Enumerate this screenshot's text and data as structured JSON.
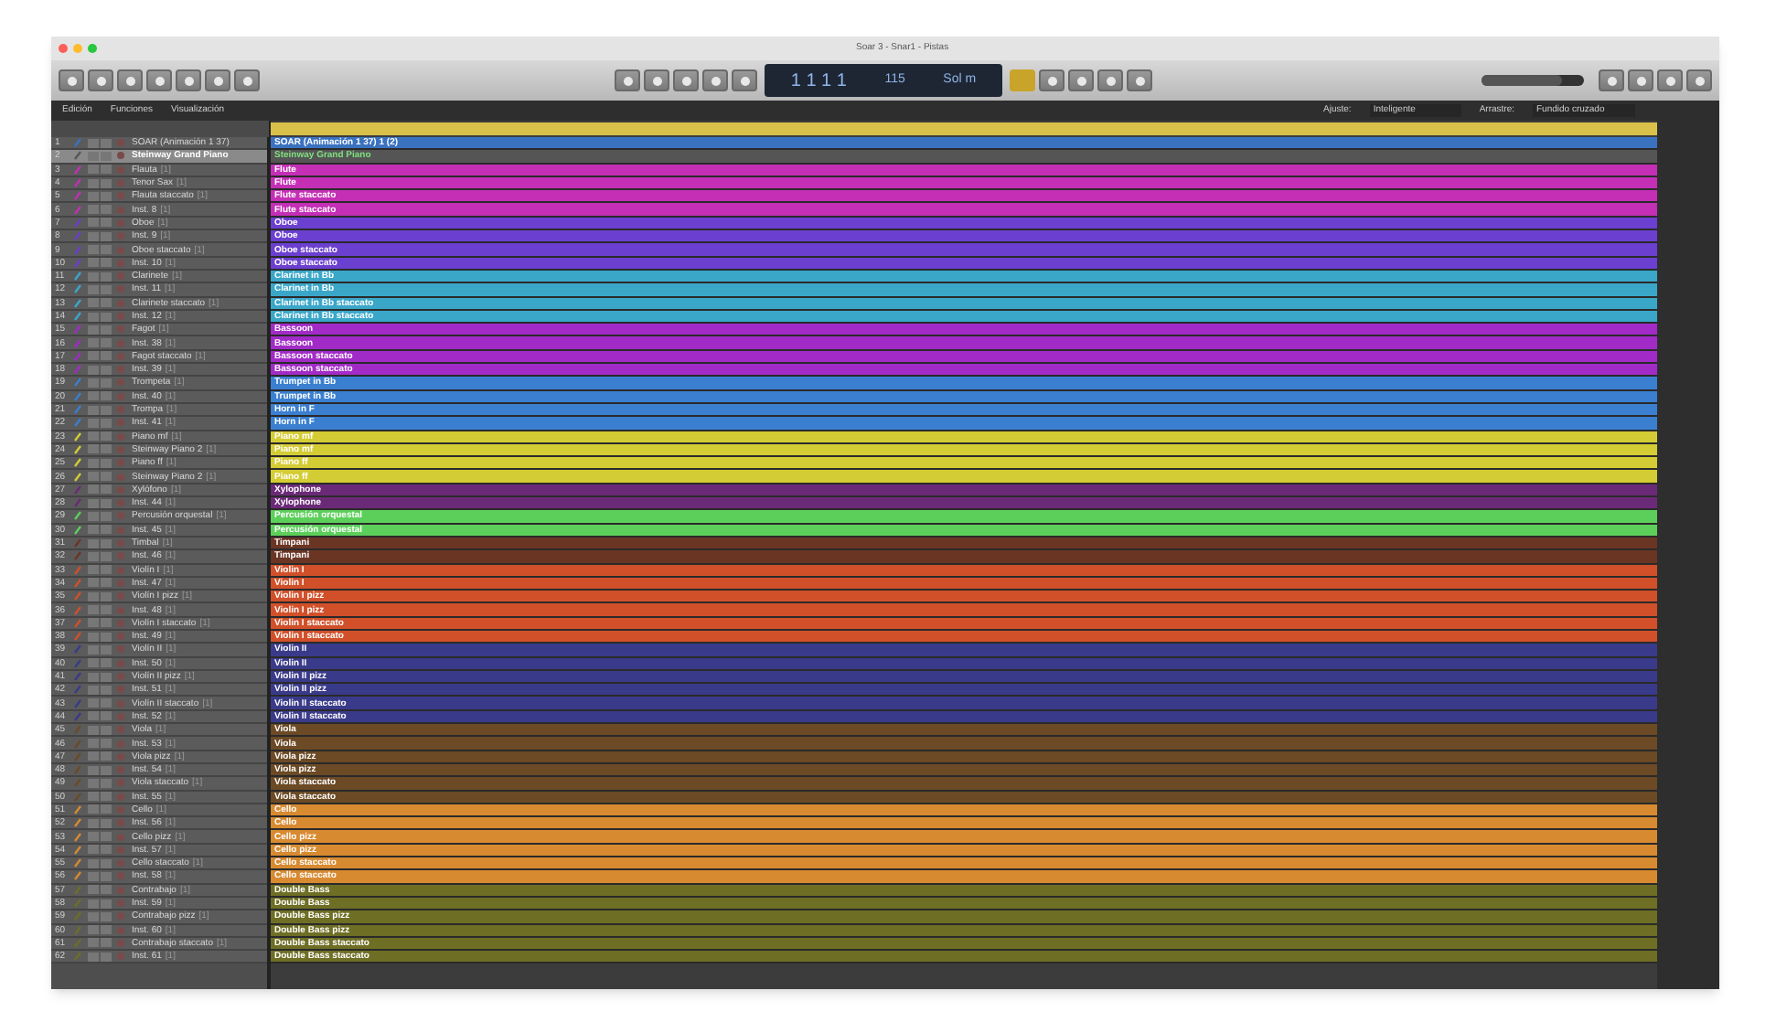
{
  "window": {
    "title": "Soar 3 - Snar1 - Pistas"
  },
  "lcd": {
    "position": "1 1 1 1",
    "tempo": "115",
    "key": "Sol m"
  },
  "master_volume": {
    "level": 0.78
  },
  "menu": [
    "Edición",
    "Funciones",
    "Visualización"
  ],
  "snap": {
    "label": "Ajuste:",
    "value": "Inteligente"
  },
  "drag": {
    "label": "Arrastre:",
    "value": "Fundido cruzado"
  },
  "tracks": [
    {
      "number": "1",
      "name": "SOAR (Animación 1 37)",
      "region": "SOAR (Animación 1 37) 1 (2)",
      "color": "#3a72c0",
      "selected": false
    },
    {
      "number": "2",
      "name": "Steinway Grand Piano",
      "region": "Steinway Grand Piano",
      "color": "#555555",
      "selected": true
    },
    {
      "number": "3",
      "name": "Flauta",
      "tag": "[1]",
      "region": "Flute",
      "color": "#c42fb5",
      "selected": false
    },
    {
      "number": "4",
      "name": "Tenor Sax",
      "tag": "[1]",
      "region": "Flute",
      "color": "#c42fb5",
      "selected": false
    },
    {
      "number": "5",
      "name": "Flauta staccato",
      "tag": "[1]",
      "region": "Flute staccato",
      "color": "#c42fb5",
      "selected": false
    },
    {
      "number": "6",
      "name": "Inst. 8",
      "tag": "[1]",
      "region": "Flute staccato",
      "color": "#c42fb5",
      "selected": false
    },
    {
      "number": "7",
      "name": "Oboe",
      "tag": "[1]",
      "region": "Oboe",
      "color": "#6b3fd0",
      "selected": false
    },
    {
      "number": "8",
      "name": "Inst. 9",
      "tag": "[1]",
      "region": "Oboe",
      "color": "#6b3fd0",
      "selected": false
    },
    {
      "number": "9",
      "name": "Oboe staccato",
      "tag": "[1]",
      "region": "Oboe staccato",
      "color": "#6b3fd0",
      "selected": false
    },
    {
      "number": "10",
      "name": "Inst. 10",
      "tag": "[1]",
      "region": "Oboe staccato",
      "color": "#6b3fd0",
      "selected": false
    },
    {
      "number": "11",
      "name": "Clarinete",
      "tag": "[1]",
      "region": "Clarinet in Bb",
      "color": "#3aa7c9",
      "selected": false
    },
    {
      "number": "12",
      "name": "Inst. 11",
      "tag": "[1]",
      "region": "Clarinet in Bb",
      "color": "#3aa7c9",
      "selected": false
    },
    {
      "number": "13",
      "name": "Clarinete staccato",
      "tag": "[1]",
      "region": "Clarinet in Bb staccato",
      "color": "#3aa7c9",
      "selected": false
    },
    {
      "number": "14",
      "name": "Inst. 12",
      "tag": "[1]",
      "region": "Clarinet in Bb staccato",
      "color": "#3aa7c9",
      "selected": false
    },
    {
      "number": "15",
      "name": "Fagot",
      "tag": "[1]",
      "region": "Bassoon",
      "color": "#a22bc8",
      "selected": false
    },
    {
      "number": "16",
      "name": "Inst. 38",
      "tag": "[1]",
      "region": "Bassoon",
      "color": "#a22bc8",
      "selected": false
    },
    {
      "number": "17",
      "name": "Fagot staccato",
      "tag": "[1]",
      "region": "Bassoon staccato",
      "color": "#a22bc8",
      "selected": false
    },
    {
      "number": "18",
      "name": "Inst. 39",
      "tag": "[1]",
      "region": "Bassoon staccato",
      "color": "#a22bc8",
      "selected": false
    },
    {
      "number": "19",
      "name": "Trompeta",
      "tag": "[1]",
      "region": "Trumpet in Bb",
      "color": "#3a7fd0",
      "selected": false
    },
    {
      "number": "20",
      "name": "Inst. 40",
      "tag": "[1]",
      "region": "Trumpet in Bb",
      "color": "#3a7fd0",
      "selected": false
    },
    {
      "number": "21",
      "name": "Trompa",
      "tag": "[1]",
      "region": "Horn in F",
      "color": "#3a7fd0",
      "selected": false
    },
    {
      "number": "22",
      "name": "Inst. 41",
      "tag": "[1]",
      "region": "Horn in F",
      "color": "#3a7fd0",
      "selected": false
    },
    {
      "number": "23",
      "name": "Piano mf",
      "tag": "[1]",
      "region": "Piano mf",
      "color": "#d4cc34",
      "selected": false
    },
    {
      "number": "24",
      "name": "Steinway Piano 2",
      "tag": "[1]",
      "region": "Piano mf",
      "color": "#d4cc34",
      "selected": false
    },
    {
      "number": "25",
      "name": "Piano ff",
      "tag": "[1]",
      "region": "Piano ff",
      "color": "#d4cc34",
      "selected": false
    },
    {
      "number": "26",
      "name": "Steinway Piano 2",
      "tag": "[1]",
      "region": "Piano ff",
      "color": "#d4cc34",
      "selected": false
    },
    {
      "number": "27",
      "name": "Xylófono",
      "tag": "[1]",
      "region": "Xylophone",
      "color": "#6b2a78",
      "selected": false
    },
    {
      "number": "28",
      "name": "Inst. 44",
      "tag": "[1]",
      "region": "Xylophone",
      "color": "#6b2a78",
      "selected": false
    },
    {
      "number": "29",
      "name": "Percusión orquestal",
      "tag": "[1]",
      "region": "Percusión orquestal",
      "color": "#5ccf5a",
      "selected": false
    },
    {
      "number": "30",
      "name": "Inst. 45",
      "tag": "[1]",
      "region": "Percusión orquestal",
      "color": "#5ccf5a",
      "selected": false
    },
    {
      "number": "31",
      "name": "Timbal",
      "tag": "[1]",
      "region": "Timpani",
      "color": "#6b3524",
      "selected": false
    },
    {
      "number": "32",
      "name": "Inst. 46",
      "tag": "[1]",
      "region": "Timpani",
      "color": "#6b3524",
      "selected": false
    },
    {
      "number": "33",
      "name": "Violín I",
      "tag": "[1]",
      "region": "Violin I",
      "color": "#d1502a",
      "selected": false
    },
    {
      "number": "34",
      "name": "Inst. 47",
      "tag": "[1]",
      "region": "Violin I",
      "color": "#d1502a",
      "selected": false
    },
    {
      "number": "35",
      "name": "Violín I pizz",
      "tag": "[1]",
      "region": "Violin I pizz",
      "color": "#d1502a",
      "selected": false
    },
    {
      "number": "36",
      "name": "Inst. 48",
      "tag": "[1]",
      "region": "Violin I pizz",
      "color": "#d1502a",
      "selected": false
    },
    {
      "number": "37",
      "name": "Violín I staccato",
      "tag": "[1]",
      "region": "Violin I staccato",
      "color": "#d1502a",
      "selected": false
    },
    {
      "number": "38",
      "name": "Inst. 49",
      "tag": "[1]",
      "region": "Violin I staccato",
      "color": "#d1502a",
      "selected": false
    },
    {
      "number": "39",
      "name": "Violín II",
      "tag": "[1]",
      "region": "Violin II",
      "color": "#3a3a8a",
      "selected": false
    },
    {
      "number": "40",
      "name": "Inst. 50",
      "tag": "[1]",
      "region": "Violin II",
      "color": "#3a3a8a",
      "selected": false
    },
    {
      "number": "41",
      "name": "Violín II pizz",
      "tag": "[1]",
      "region": "Violin II pizz",
      "color": "#3a3a8a",
      "selected": false
    },
    {
      "number": "42",
      "name": "Inst. 51",
      "tag": "[1]",
      "region": "Violin II pizz",
      "color": "#3a3a8a",
      "selected": false
    },
    {
      "number": "43",
      "name": "Violín II staccato",
      "tag": "[1]",
      "region": "Violin II staccato",
      "color": "#3a3a8a",
      "selected": false
    },
    {
      "number": "44",
      "name": "Inst. 52",
      "tag": "[1]",
      "region": "Violin II staccato",
      "color": "#3a3a8a",
      "selected": false
    },
    {
      "number": "45",
      "name": "Viola",
      "tag": "[1]",
      "region": "Viola",
      "color": "#6b4a25",
      "selected": false
    },
    {
      "number": "46",
      "name": "Inst. 53",
      "tag": "[1]",
      "region": "Viola",
      "color": "#6b4a25",
      "selected": false
    },
    {
      "number": "47",
      "name": "Viola pizz",
      "tag": "[1]",
      "region": "Viola pizz",
      "color": "#6b4a25",
      "selected": false
    },
    {
      "number": "48",
      "name": "Inst. 54",
      "tag": "[1]",
      "region": "Viola pizz",
      "color": "#6b4a25",
      "selected": false
    },
    {
      "number": "49",
      "name": "Viola staccato",
      "tag": "[1]",
      "region": "Viola staccato",
      "color": "#6b4a25",
      "selected": false
    },
    {
      "number": "50",
      "name": "Inst. 55",
      "tag": "[1]",
      "region": "Viola staccato",
      "color": "#6b4a25",
      "selected": false
    },
    {
      "number": "51",
      "name": "Cello",
      "tag": "[1]",
      "region": "Cello",
      "color": "#d88a30",
      "selected": false
    },
    {
      "number": "52",
      "name": "Inst. 56",
      "tag": "[1]",
      "region": "Cello",
      "color": "#d88a30",
      "selected": false
    },
    {
      "number": "53",
      "name": "Cello pizz",
      "tag": "[1]",
      "region": "Cello pizz",
      "color": "#d88a30",
      "selected": false
    },
    {
      "number": "54",
      "name": "Inst. 57",
      "tag": "[1]",
      "region": "Cello pizz",
      "color": "#d88a30",
      "selected": false
    },
    {
      "number": "55",
      "name": "Cello staccato",
      "tag": "[1]",
      "region": "Cello staccato",
      "color": "#d88a30",
      "selected": false
    },
    {
      "number": "56",
      "name": "Inst. 58",
      "tag": "[1]",
      "region": "Cello staccato",
      "color": "#d88a30",
      "selected": false
    },
    {
      "number": "57",
      "name": "Contrabajo",
      "tag": "[1]",
      "region": "Double Bass",
      "color": "#6e6e25",
      "selected": false
    },
    {
      "number": "58",
      "name": "Inst. 59",
      "tag": "[1]",
      "region": "Double Bass",
      "color": "#6e6e25",
      "selected": false
    },
    {
      "number": "59",
      "name": "Contrabajo pizz",
      "tag": "[1]",
      "region": "Double Bass pizz",
      "color": "#6e6e25",
      "selected": false
    },
    {
      "number": "60",
      "name": "Inst. 60",
      "tag": "[1]",
      "region": "Double Bass pizz",
      "color": "#6e6e25",
      "selected": false
    },
    {
      "number": "61",
      "name": "Contrabajo staccato",
      "tag": "[1]",
      "region": "Double Bass staccato",
      "color": "#6e6e25",
      "selected": false
    },
    {
      "number": "62",
      "name": "Inst. 61",
      "tag": "[1]",
      "region": "Double Bass staccato",
      "color": "#6e6e25",
      "selected": false
    }
  ]
}
